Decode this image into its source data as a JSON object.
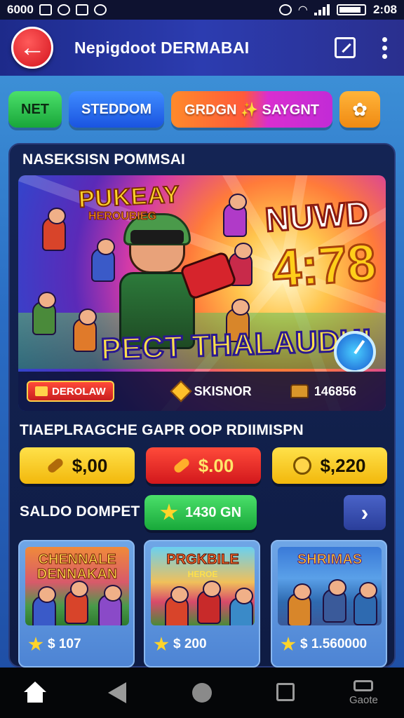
{
  "status_bar": {
    "left_text": "6000",
    "time": "2:08",
    "icons": [
      "notification-icon",
      "shield-icon",
      "gallery-icon",
      "media-icon",
      "wifi-icon",
      "signal-icon",
      "battery-icon"
    ]
  },
  "header": {
    "title": "Nepigdoot DERMABAI",
    "back_glyph": "←",
    "icons": [
      "back-arrow-icon",
      "edit-icon",
      "more-vertical-icon"
    ]
  },
  "chips": [
    {
      "label": "NET"
    },
    {
      "label": "STEDDOM"
    },
    {
      "label": "GRDGN ✨ SAYGNT"
    },
    {
      "label": "✿"
    }
  ],
  "promo_section": {
    "title": "NASEKSISN POMMSAI",
    "banner": {
      "logo": "PUKEAY",
      "logo_sub": "HEROUBIEG",
      "headline": "NUWD",
      "number": "4:78",
      "slogan": "PECT THALAUDH!",
      "footer_badge": "DEROLAW",
      "footer_mid": "SKISNOR",
      "footer_right": "146856"
    }
  },
  "prices": {
    "title": "TIAEPLRAGCHE GAPR OOP RDIIMISPN",
    "items": [
      {
        "label": "$,00",
        "style": "yellow"
      },
      {
        "label": "$.00",
        "style": "red"
      },
      {
        "label": "$,220",
        "style": "yellow"
      }
    ]
  },
  "wallet": {
    "title": "SALDO DOMPET",
    "balance": "1430 GN",
    "next_glyph": "›"
  },
  "games": [
    {
      "title": "CHENNALE DENNAKAN",
      "rating": "$ 107"
    },
    {
      "title": "PRGKBILE",
      "subtitle": "HEROE",
      "rating": "$ 200"
    },
    {
      "title": "SHRIMAS",
      "rating": "$ 1.560000"
    }
  ],
  "nav": {
    "games_label": "Gaote"
  },
  "colors": {
    "accent_red": "#d4141e",
    "green": "#19a63a",
    "blue": "#1a54e0",
    "yellow": "#f2b80c",
    "card_bg": "#142454"
  }
}
